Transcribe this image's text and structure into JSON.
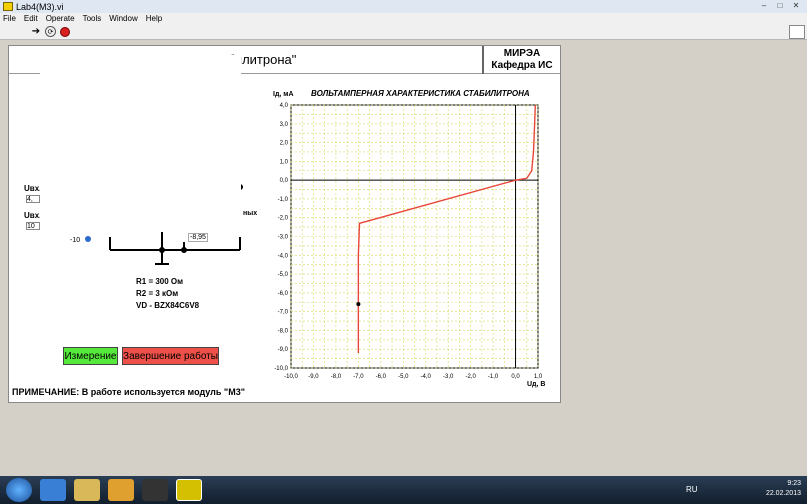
{
  "window": {
    "title": "Lab4(M3).vi"
  },
  "menu": [
    "File",
    "Edit",
    "Operate",
    "Tools",
    "Window",
    "Help"
  ],
  "header": {
    "title": "\"Р                  ование характеристик стабилитрона\"",
    "org_line1": "МИРЭА",
    "org_line2": "Кафедра ИС"
  },
  "controls": {
    "uin1_label": "Uвх.",
    "uin1_value": "4,",
    "uin2_label": "Uвх.",
    "uin2_value": "10",
    "knob_min": "-10",
    "meter_value": "-8,95",
    "side_text": "ных"
  },
  "params": {
    "r1": "R1 = 300 Ом",
    "r2": "R2 = 3 кОм",
    "vd": "VD - BZX84C6V8"
  },
  "buttons": {
    "measure": "Измерение",
    "exit": "Завершение работы"
  },
  "note": "ПРИМЕЧАНИЕ: В работе используется модуль \"М3\"",
  "taskbar": {
    "lang": "RU",
    "time": "9:23",
    "date": "22.02.2013"
  },
  "colors": {
    "plot_line": "#e8463a",
    "grid": "#d8d860",
    "measure_button": "#56e83a",
    "exit_button": "#ec5048"
  },
  "chart_data": {
    "type": "line",
    "title": "ВОЛЬТАМПЕРНАЯ ХАРАКТЕРИСТИКА СТАБИЛИТРОНА",
    "xlabel": "Uд, В",
    "ylabel": "Iд, мА",
    "xlim": [
      -10,
      1
    ],
    "ylim": [
      -10,
      4
    ],
    "x_ticks": [
      "-10,0",
      "-9,0",
      "-8,0",
      "-7,0",
      "-6,0",
      "-5,0",
      "-4,0",
      "-3,0",
      "-2,0",
      "-1,0",
      "0,0",
      "1,0"
    ],
    "y_ticks": [
      "4,0",
      "3,0",
      "2,0",
      "1,0",
      "0,0",
      "-1,0",
      "-2,0",
      "-3,0",
      "-4,0",
      "-5,0",
      "-6,0",
      "-7,0",
      "-8,0",
      "-9,0",
      "-10,0"
    ],
    "grid": true,
    "series": [
      {
        "x": [
          -7.0,
          -7.0,
          -6.95,
          0.0,
          0.5,
          0.72,
          0.8,
          0.85,
          0.88
        ],
        "y": [
          -9.2,
          -4.0,
          -2.3,
          0.0,
          0.1,
          0.5,
          1.5,
          3.0,
          4.0
        ]
      }
    ],
    "markers": [
      {
        "x": -7.0,
        "y": -6.6
      }
    ]
  }
}
